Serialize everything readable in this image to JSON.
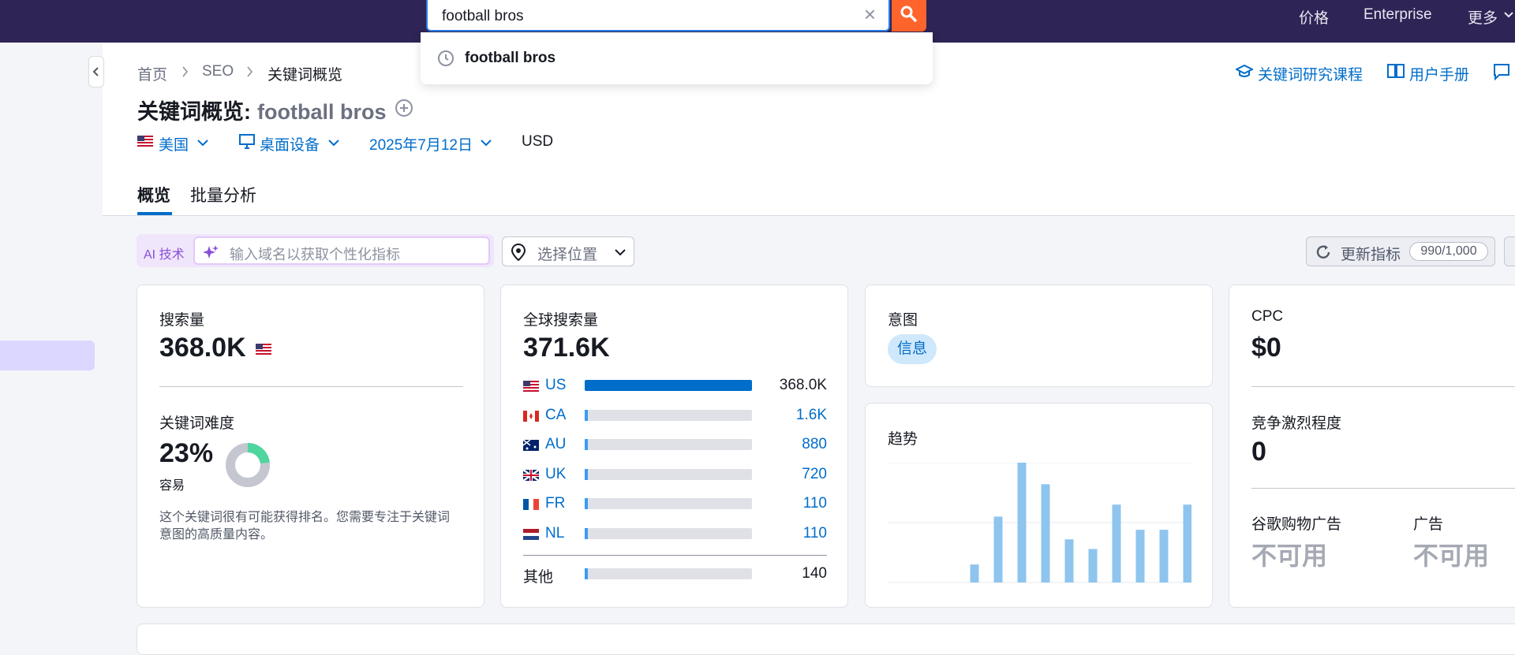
{
  "topnav": {
    "pricing": "价格",
    "enterprise": "Enterprise",
    "more": "更多"
  },
  "search": {
    "value": "football bros",
    "suggestion": "football bros"
  },
  "breadcrumb": {
    "home": "首页",
    "seo": "SEO",
    "current": "关键词概览"
  },
  "header_links": {
    "course": "关键词研究课程",
    "manual": "用户手册"
  },
  "title": {
    "prefix": "关键词概览:",
    "keyword": "football bros"
  },
  "filters": {
    "country": "美国",
    "device": "桌面设备",
    "date": "2025年7月12日",
    "currency": "USD"
  },
  "tabs": {
    "overview": "概览",
    "bulk": "批量分析"
  },
  "toolbar": {
    "ai_tag": "AI 技术",
    "ai_placeholder": "输入域名以获取个性化指标",
    "location": "选择位置",
    "update": "更新指标",
    "quota": "990/1,000"
  },
  "volume_card": {
    "label": "搜索量",
    "value": "368.0K",
    "kd_label": "关键词难度",
    "kd_value": "23%",
    "kd_level": "容易",
    "kd_percent": 23,
    "kd_note_1": "这个关键词很有可能获得排名。您需要专注于关键词",
    "kd_note_2": "意图的高质量内容。"
  },
  "global_card": {
    "label": "全球搜索量",
    "value": "371.6K",
    "rows": [
      {
        "code": "US",
        "value": "368.0K",
        "share": 1.0
      },
      {
        "code": "CA",
        "value": "1.6K",
        "share": 0.015
      },
      {
        "code": "AU",
        "value": "880",
        "share": 0.015
      },
      {
        "code": "UK",
        "value": "720",
        "share": 0.015
      },
      {
        "code": "FR",
        "value": "110",
        "share": 0.015
      },
      {
        "code": "NL",
        "value": "110",
        "share": 0.015
      }
    ],
    "other_label": "其他",
    "other_value": "140"
  },
  "intent_card": {
    "label": "意图",
    "badge": "信息"
  },
  "trend_card": {
    "label": "趋势"
  },
  "chart_data": {
    "type": "bar",
    "values": [
      0,
      0,
      0,
      15,
      55,
      100,
      82,
      36,
      28,
      65,
      44,
      44,
      65
    ],
    "ylim": [
      0,
      100
    ]
  },
  "cpc_card": {
    "label": "CPC",
    "value": "$0",
    "comp_label": "竞争激烈程度",
    "comp_value": "0",
    "shopping_label": "谷歌购物广告",
    "shopping_value": "不可用",
    "ads_label": "广告",
    "ads_value": "不可用"
  },
  "colors": {
    "topbar": "#2e2455",
    "accent": "#006dca",
    "search_btn": "#ff642d",
    "kd_green": "#4fd59e",
    "trend_bar": "#8ec5ee"
  }
}
